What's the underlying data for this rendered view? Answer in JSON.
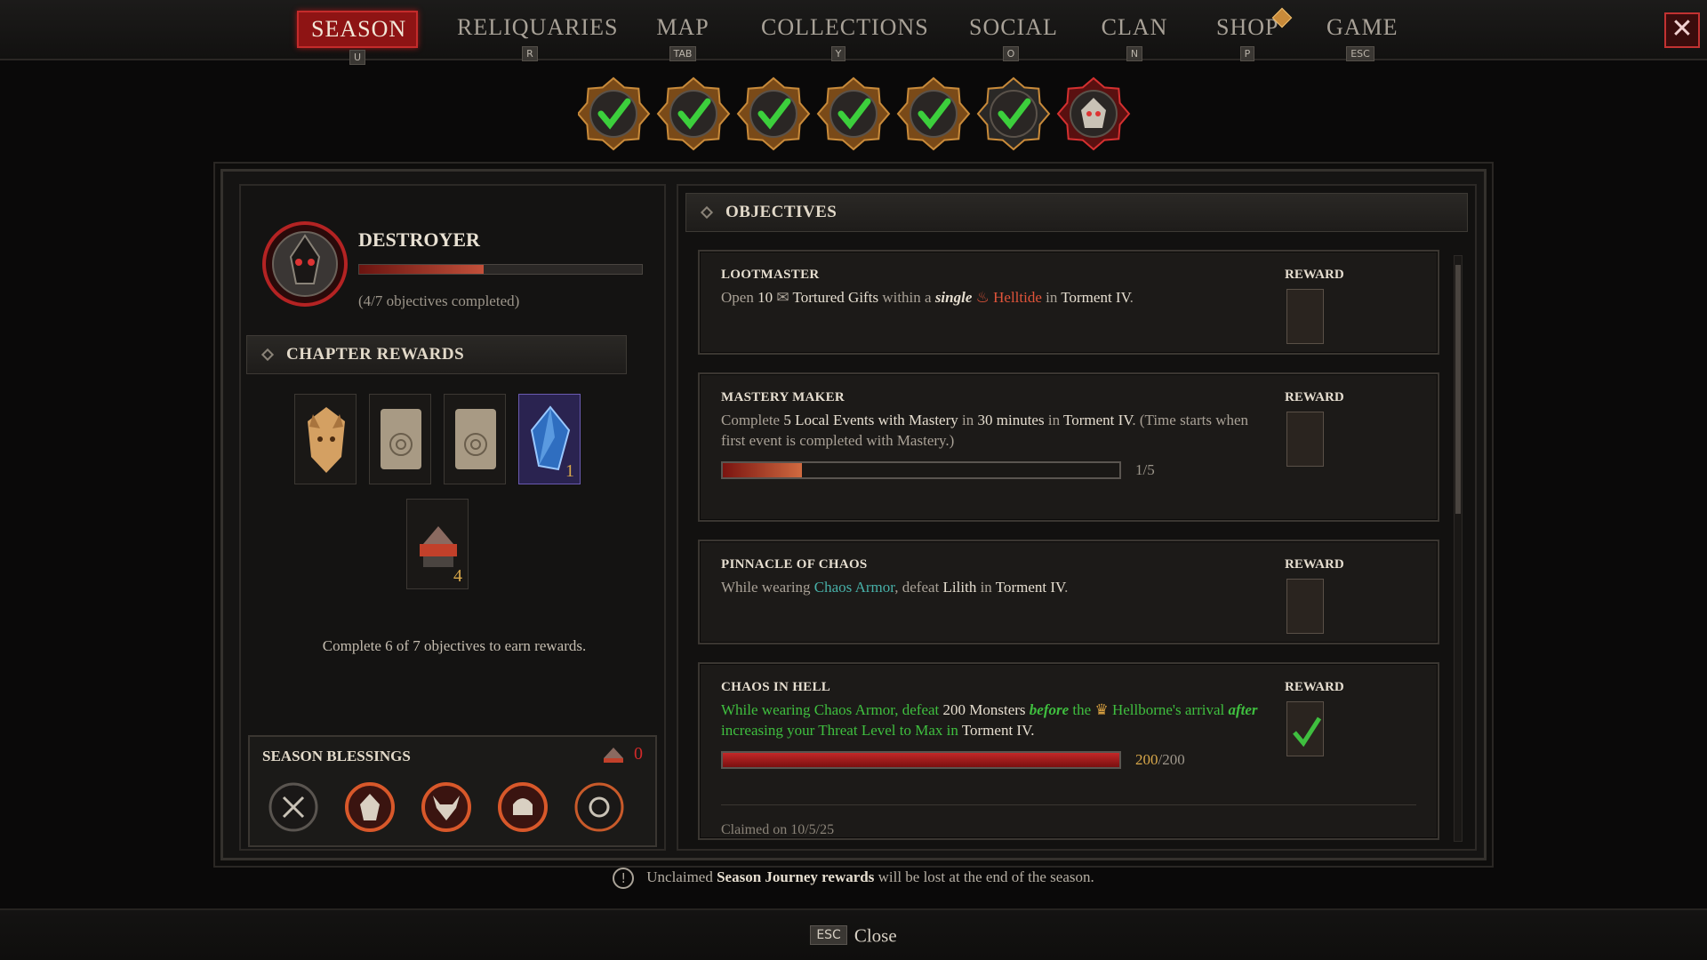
{
  "nav": {
    "tabs": [
      {
        "label": "SEASON",
        "key": "U"
      },
      {
        "label": "RELIQUARIES",
        "key": "R"
      },
      {
        "label": "MAP",
        "key": "TAB"
      },
      {
        "label": "COLLECTIONS",
        "key": "Y"
      },
      {
        "label": "SOCIAL",
        "key": "O"
      },
      {
        "label": "CLAN",
        "key": "N"
      },
      {
        "label": "SHOP",
        "key": "P"
      },
      {
        "label": "GAME",
        "key": "ESC"
      }
    ],
    "close_symbol": "✕"
  },
  "chapter_medals": [
    {
      "state": "completed",
      "icon": "checkmark-medal-icon"
    },
    {
      "state": "completed",
      "icon": "checkmark-medal-icon"
    },
    {
      "state": "completed",
      "icon": "checkmark-medal-icon"
    },
    {
      "state": "completed",
      "icon": "checkmark-medal-icon"
    },
    {
      "state": "completed",
      "icon": "checkmark-medal-icon"
    },
    {
      "state": "completed",
      "icon": "checkmark-medal-icon"
    },
    {
      "state": "current",
      "icon": "destroyer-skull-medal-icon"
    }
  ],
  "chapter": {
    "name": "DESTROYER",
    "progress_fraction": 0.44,
    "status": "(4/7 objectives completed)"
  },
  "chapter_rewards": {
    "header": "CHAPTER REWARDS",
    "items": [
      {
        "icon": "wolf-cosmetic-icon",
        "count": ""
      },
      {
        "icon": "scroll-icon",
        "count": ""
      },
      {
        "icon": "scroll-icon",
        "count": ""
      },
      {
        "icon": "crystal-icon",
        "count": "1"
      },
      {
        "icon": "anvil-icon",
        "count": "4"
      }
    ],
    "note": "Complete 6 of 7 objectives to earn rewards."
  },
  "season_blessings": {
    "title": "SEASON BLESSINGS",
    "count": "0",
    "icons": [
      "crossed-tools-icon",
      "beast-head-icon",
      "horned-skull-icon",
      "helm-icon",
      "spiked-orb-icon"
    ]
  },
  "objectives": {
    "header": "OBJECTIVES",
    "reward_label": "REWARD",
    "items": [
      {
        "title": "LOOTMASTER",
        "parts": [
          "Open ",
          "10",
          " Tortured Gifts",
          " within a ",
          "single",
          " Helltide",
          " in ",
          "Torment IV",
          "."
        ],
        "completed": false
      },
      {
        "title": "MASTERY MAKER",
        "parts": [
          "Complete ",
          "5 Local Events with Mastery",
          " in ",
          "30 minutes",
          " in ",
          "Torment IV",
          ". (Time starts when first event is completed with Mastery.)"
        ],
        "progress_text": "1/5",
        "progress_fraction": 0.2,
        "completed": false
      },
      {
        "title": "PINNACLE OF CHAOS",
        "parts": [
          "While wearing ",
          "Chaos Armor",
          ", defeat ",
          "Lilith",
          " in ",
          "Torment IV",
          "."
        ],
        "completed": false
      },
      {
        "title": "CHAOS IN HELL",
        "parts": [
          "While wearing Chaos Armor, defeat ",
          "200 Monsters",
          "before",
          " the ",
          "Hellborne's arrival ",
          "after",
          " increasing your Threat Level to Max in ",
          "Torment IV",
          "."
        ],
        "progress_value": "200",
        "progress_total": "/200",
        "progress_fraction": 1.0,
        "claimed": "Claimed on 10/5/25",
        "completed": true
      }
    ]
  },
  "warning": {
    "pre": "Unclaimed ",
    "bold": "Season Journey rewards",
    "post": " will be lost at the end of the season."
  },
  "footer": {
    "key": "ESC",
    "label": "Close"
  },
  "colors": {
    "accent_red": "#8e1414",
    "objective_green": "#3fbf3f",
    "helltide_red": "#e0543a",
    "chaos_teal": "#47b0a8",
    "count_gold": "#d9a84a"
  }
}
